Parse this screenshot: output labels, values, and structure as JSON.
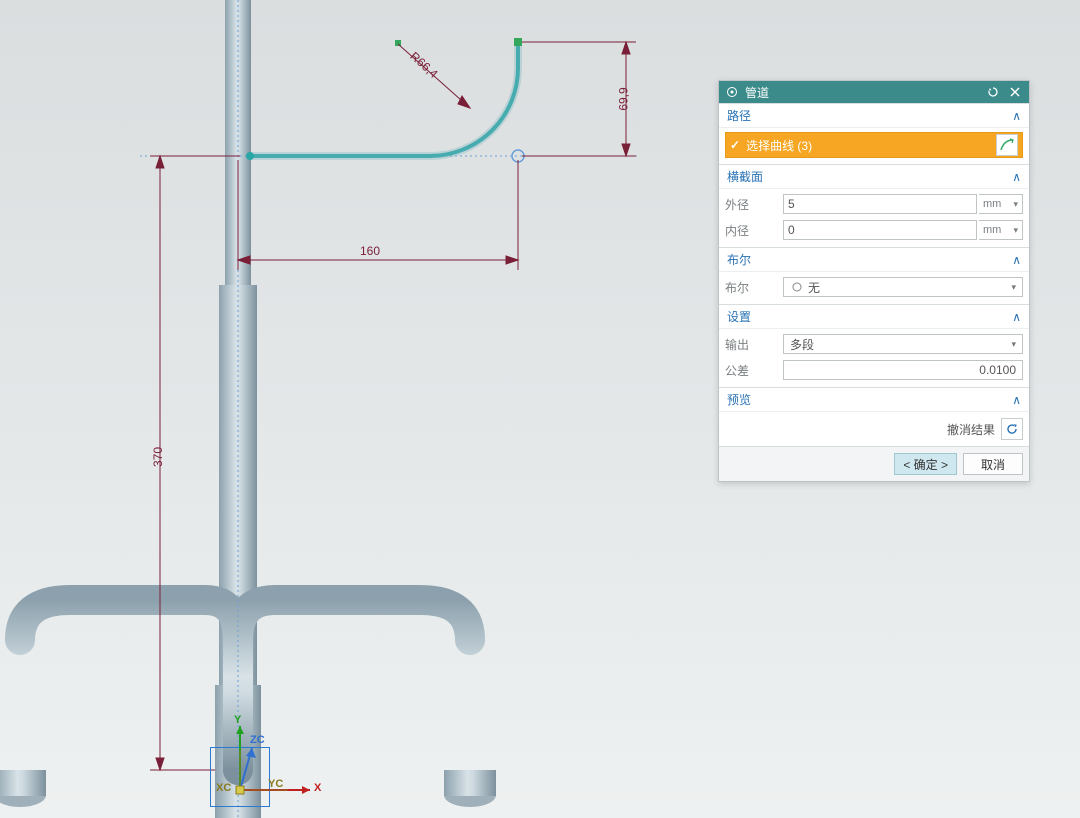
{
  "colors": {
    "dialog_header": "#3b8b8b",
    "accent_blue": "#2a73b5",
    "selection_orange": "#f6a623",
    "dimension": "#7a1f38",
    "sketch_cyan": "#2aa6a6"
  },
  "dimensions": {
    "vertical_long": "370",
    "horizontal": "160",
    "radius": "R66,4",
    "vertical_short": "69,9"
  },
  "triad": {
    "x": "X",
    "y": "Y",
    "zc": "ZC",
    "xc": "XC",
    "yc": "YC"
  },
  "dialog": {
    "title": "管道",
    "sections": {
      "path": {
        "title": "路径",
        "select_curve_label": "选择曲线 (3)"
      },
      "cross_section": {
        "title": "横截面",
        "outer_diameter_label": "外径",
        "outer_diameter_value": "5",
        "outer_diameter_unit": "mm",
        "inner_diameter_label": "内径",
        "inner_diameter_value": "0",
        "inner_diameter_unit": "mm"
      },
      "boolean": {
        "title": "布尔",
        "param_label": "布尔",
        "value": "无"
      },
      "settings": {
        "title": "设置",
        "output_label": "输出",
        "output_value": "多段",
        "tolerance_label": "公差",
        "tolerance_value": "0.0100"
      },
      "preview": {
        "title": "预览",
        "undo_label": "撤消结果"
      }
    },
    "buttons": {
      "ok": "< 确定 >",
      "cancel": "取消"
    }
  }
}
